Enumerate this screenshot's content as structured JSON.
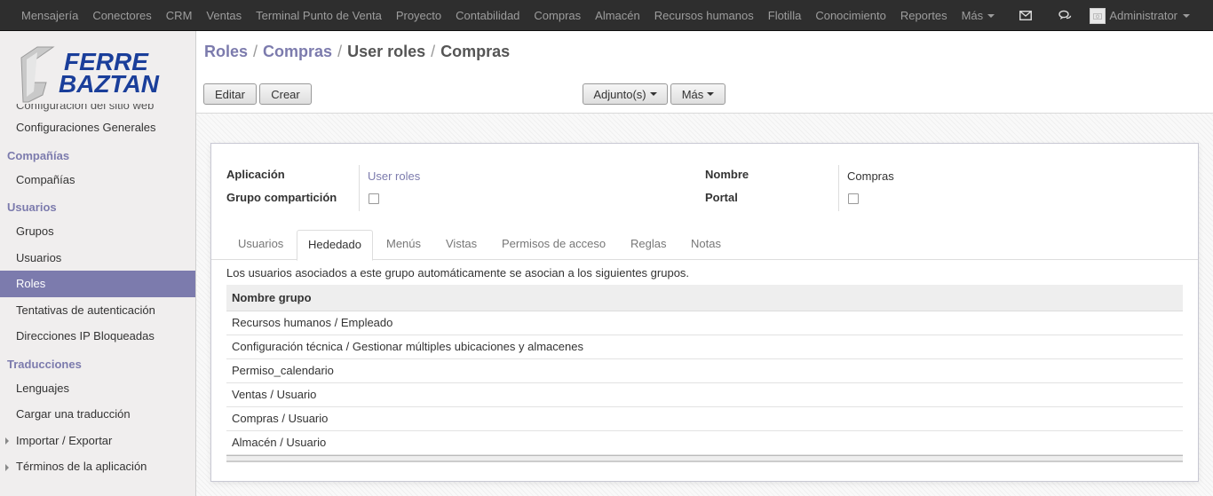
{
  "topbar": {
    "menu": [
      "Mensajería",
      "Conectores",
      "CRM",
      "Ventas",
      "Terminal Punto de Venta",
      "Proyecto",
      "Contabilidad",
      "Compras",
      "Almacén",
      "Recursos humanos",
      "Flotilla",
      "Conocimiento",
      "Reportes"
    ],
    "more_label": "Más",
    "user_name": "Administrator"
  },
  "logo": {
    "line1": "FERRE",
    "line2": "BAZTAN",
    "color": "#1a3e9a"
  },
  "sidebar": {
    "cut_item": "Configuración del sitio web",
    "config_general": "Configuraciones Generales",
    "companias_head": "Compañías",
    "companias_item": "Compañías",
    "usuarios_head": "Usuarios",
    "grupos": "Grupos",
    "usuarios": "Usuarios",
    "roles": "Roles",
    "tentativas": "Tentativas de autenticación",
    "direcciones": "Direcciones IP Bloqueadas",
    "traducciones_head": "Traducciones",
    "lenguajes": "Lenguajes",
    "cargar": "Cargar una traducción",
    "importar": "Importar / Exportar",
    "terminos": "Términos de la aplicación"
  },
  "breadcrumb": {
    "b1": "Roles",
    "b2": "Compras",
    "b3": "User roles",
    "b4": "Compras",
    "sep": "/"
  },
  "buttons": {
    "edit": "Editar",
    "create": "Crear",
    "attach": "Adjunto(s)",
    "more": "Más"
  },
  "form": {
    "app_label": "Aplicación",
    "app_value": "User roles",
    "share_label": "Grupo compartición",
    "name_label": "Nombre",
    "name_value": "Compras",
    "portal_label": "Portal"
  },
  "tabs": [
    "Usuarios",
    "Hededado",
    "Menús",
    "Vistas",
    "Permisos de acceso",
    "Reglas",
    "Notas"
  ],
  "inherited": {
    "description": "Los usuarios asociados a este grupo automáticamente se asocian a los siguientes grupos.",
    "column": "Nombre grupo",
    "rows": [
      "Recursos humanos / Empleado",
      "Configuración técnica / Gestionar múltiples ubicaciones y almacenes",
      "Permiso_calendario",
      "Ventas / Usuario",
      "Compras / Usuario",
      "Almacén / Usuario"
    ]
  },
  "colors": {
    "accent": "#7c7bad",
    "navbar": "#2e2e2e"
  }
}
